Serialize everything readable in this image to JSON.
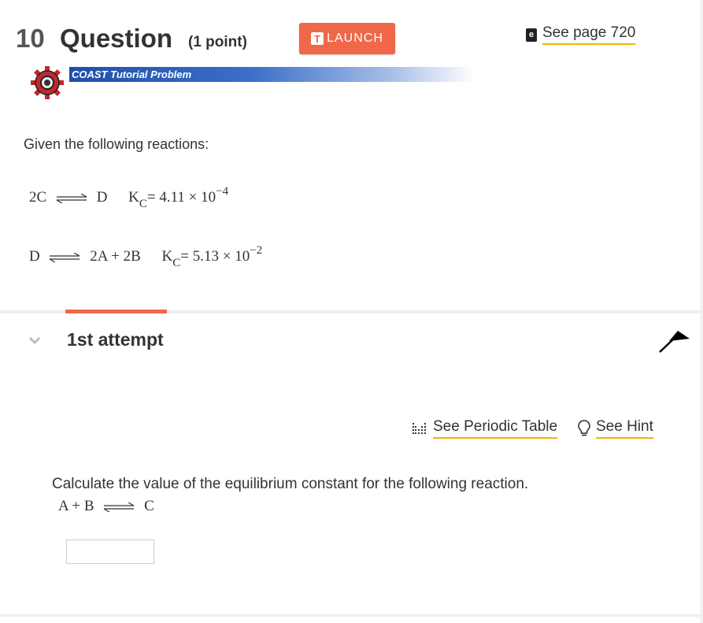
{
  "question": {
    "number": "10",
    "word": "Question",
    "points": "(1 point)",
    "launch_label": "LAUNCH",
    "launch_icon": "T",
    "see_page_label": "See page 720",
    "ebook_icon_letter": "e",
    "banner_text": "COAST Tutorial Problem"
  },
  "body": {
    "given_text": "Given the following reactions:",
    "reaction1": {
      "left": "2C",
      "right": "D",
      "k_label": "K",
      "k_sub": "C",
      "k_value": "= 4.11 × 10",
      "k_exp": "−4"
    },
    "reaction2": {
      "left": "D",
      "right": "2A + 2B",
      "k_label": "K",
      "k_sub": "C",
      "k_value": "= 5.13 × 10",
      "k_exp": "−2"
    }
  },
  "attempt": {
    "label": "1st attempt",
    "periodic_table_label": "See Periodic Table",
    "hint_label": "See Hint",
    "prompt": "Calculate the value of the equilibrium constant for the following reaction.",
    "reaction3": {
      "left": "A + B",
      "right": "C"
    },
    "answer_value": ""
  },
  "colors": {
    "accent": "#f0674a",
    "link_underline": "#f5b400",
    "banner_blue": "#1f4fa8",
    "gear_red": "#c0282d"
  },
  "icons": [
    "ebook-icon",
    "gear-icon",
    "chevron-down-icon",
    "flag-icon",
    "periodic-table-icon",
    "lightbulb-icon",
    "equilibrium-arrow-icon"
  ]
}
